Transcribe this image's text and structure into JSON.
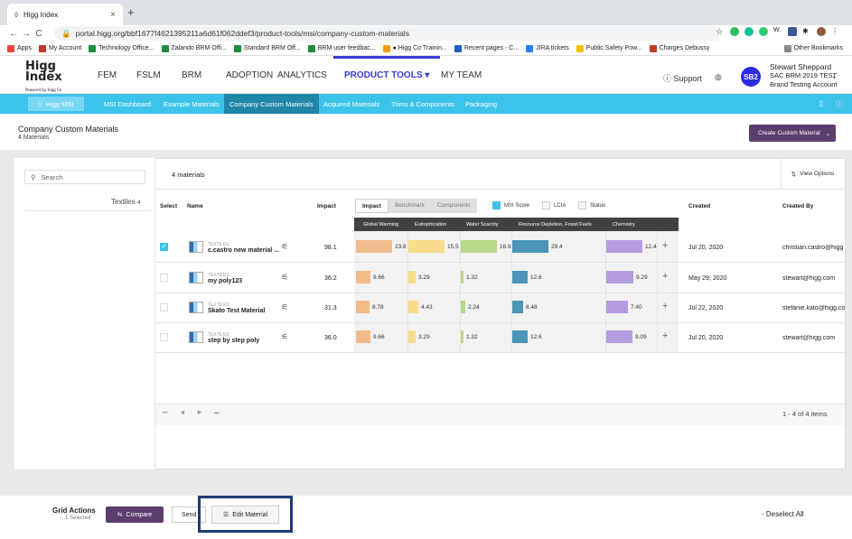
{
  "browser": {
    "tab_title": "Higg Index",
    "tab_close": "×",
    "new_tab": "+",
    "url": "portal.higg.org/bbf1677f4621395211a6d61f062ddef3/product-tools/msi/company-custom-materials",
    "bookmarks": [
      {
        "label": "Apps",
        "color": "#e8453c"
      },
      {
        "label": "My Account",
        "color": "#c0392b"
      },
      {
        "label": "Technology Office...",
        "color": "#1e8e3e"
      },
      {
        "label": "Zalando BRM Offi...",
        "color": "#1e8e3e"
      },
      {
        "label": "Standard BRM Off...",
        "color": "#1e8e3e"
      },
      {
        "label": "BRM user feedbac...",
        "color": "#1e8e3e"
      },
      {
        "label": "● Higg Co Trainin...",
        "color": "#f39c12"
      },
      {
        "label": "Recent pages - C...",
        "color": "#1f5fbf"
      },
      {
        "label": "JIRA tickets",
        "color": "#2684ff"
      },
      {
        "label": "Public Safety Pow...",
        "color": "#f4c20d"
      },
      {
        "label": "Charges Debussy",
        "color": "#c0392b"
      }
    ],
    "other_bookmarks": "Other Bookmarks"
  },
  "header": {
    "logo": "Higg Index",
    "logo_sub": "Powered by Higg Co",
    "nav": [
      "FEM",
      "FSLM",
      "BRM",
      "ADOPTION",
      "ANALYTICS",
      "PRODUCT TOOLS ▾",
      "MY TEAM"
    ],
    "support": "Support",
    "avatar": "SB2",
    "user_name": "Stewart Sheppard",
    "user_org": "SAC BRM 2019 TEST",
    "user_account": "Brand Testing Account"
  },
  "subnav": {
    "msi_button": "Higg MSI",
    "items": [
      "MSI Dashboard",
      "Example Materials",
      "Company Custom Materials",
      "Acquired Materials",
      "Trims & Components",
      "Packaging"
    ],
    "active": "Company Custom Materials"
  },
  "page": {
    "title": "Company Custom Materials",
    "subtitle": "4 Materials",
    "create_button": "Create Custom Material"
  },
  "left_panel": {
    "search_placeholder": "Search",
    "category": "Textiles",
    "category_count": "4"
  },
  "grid": {
    "count_label": "4 materials",
    "view_options": "View Options",
    "columns": {
      "select": "Select",
      "name": "Name",
      "impact": "Impact",
      "created": "Created",
      "created_by": "Created By"
    },
    "impact_tabs": [
      "Impact",
      "Benchmark",
      "Components"
    ],
    "legend": [
      {
        "label": "MSI Score",
        "checked": true
      },
      {
        "label": "LCIA",
        "checked": false
      },
      {
        "label": "Status",
        "checked": false
      }
    ],
    "impact_headers": [
      "Global Warming",
      "Eutrophication",
      "Water Scarcity",
      "Resource Depletion, Fossil Fuels",
      "Chemistry"
    ],
    "impact_colors": [
      "#f0bc8c",
      "#f8de8c",
      "#b9d88b",
      "#4a95b8",
      "#b49ddf"
    ],
    "rows": [
      {
        "checked": true,
        "tag": "TEXTILES",
        "name": "c.castro new material ...",
        "impact": "98.1",
        "values": [
          "23.8",
          "15.5",
          "16.9",
          "29.4",
          "12.4"
        ],
        "created": "Jul 20, 2020",
        "created_by": "christian.castro@higg"
      },
      {
        "checked": false,
        "tag": "TEXTILES",
        "name": "my poly123",
        "impact": "36.2",
        "values": [
          "9.66",
          "3.29",
          "1.32",
          "12.6",
          "9.29"
        ],
        "created": "May 29, 2020",
        "created_by": "stewart@higg.com"
      },
      {
        "checked": false,
        "tag": "TEXTILES",
        "name": "Skato Test Material",
        "impact": "31.3",
        "values": [
          "8.78",
          "4.43",
          "2.24",
          "8.48",
          "7.40"
        ],
        "created": "Jul 22, 2020",
        "created_by": "stefanie.kato@higg.co"
      },
      {
        "checked": false,
        "tag": "TEXTILES",
        "name": "step by step poly",
        "impact": "36.0",
        "values": [
          "9.66",
          "3.29",
          "1.32",
          "12.6",
          "9.09"
        ],
        "created": "Jul 20, 2020",
        "created_by": "stewart@higg.com"
      }
    ],
    "pager": "⏮ ◀ ▶ ⏭",
    "page_count": "1 - 4 of 4 items"
  },
  "footer": {
    "grid_actions": "Grid Actions",
    "selected": "1 Selected",
    "compare": "Compare",
    "send": "Send",
    "edit_material": "Edit Material",
    "deselect_all": "- Deselect All"
  }
}
